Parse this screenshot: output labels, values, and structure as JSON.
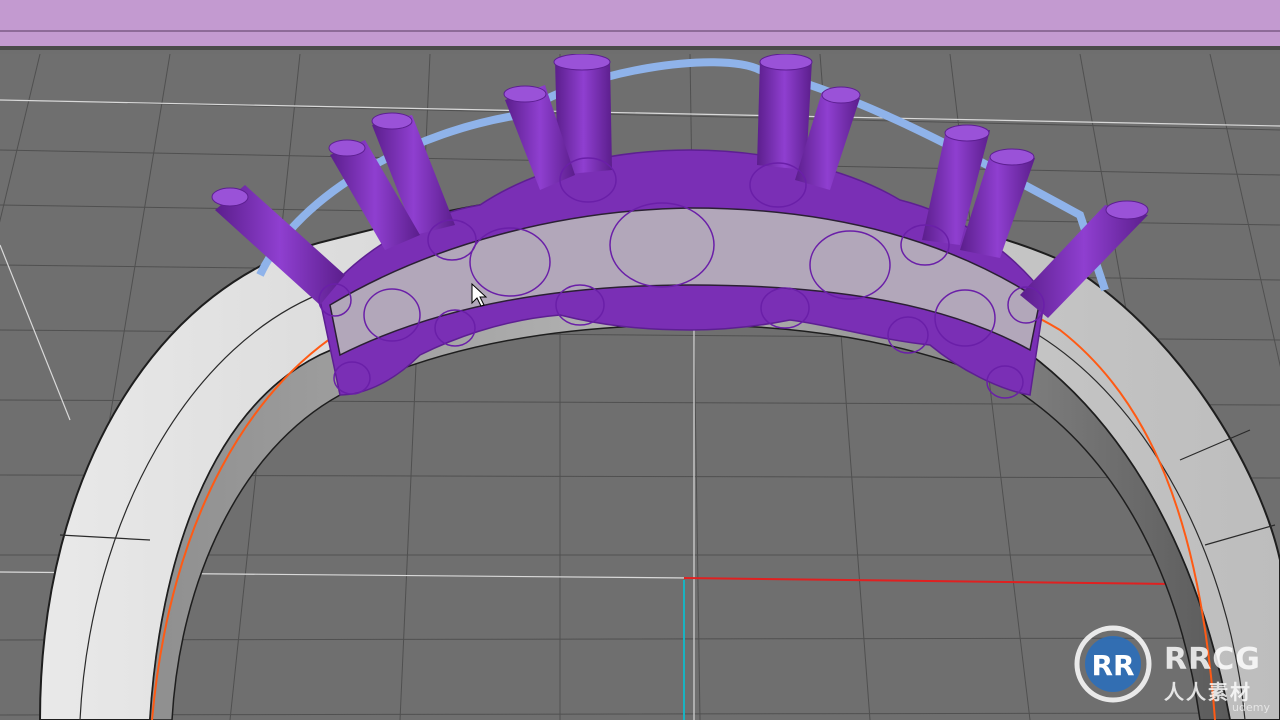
{
  "app": {
    "title": "3D jewelry modeling viewport"
  },
  "colors": {
    "toolbar": "#c39ad0",
    "grid": "#6e6e6e",
    "gem_setting": "#7a2fb5",
    "ring_band": "#d4d4d4",
    "axis_x": "#e02020",
    "axis_y": "#19b3c2",
    "curve": "#ff5a14"
  },
  "watermark": {
    "brand": "RRCG",
    "subtitle": "人人素材",
    "corner": "udemy"
  }
}
